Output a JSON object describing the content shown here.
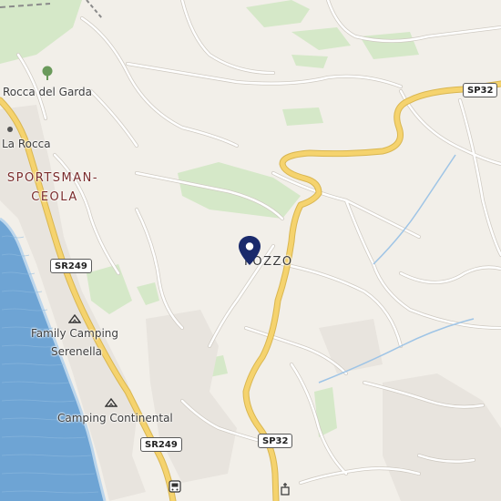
{
  "map": {
    "places": {
      "rocca_del_garda": "Rocca del Garda",
      "la_rocca": "La Rocca",
      "sportsman_line1": "SPORTSMAN-",
      "sportsman_line2": "CEOLA",
      "pozzo": "POZZO",
      "family_camping_line1": "Family Camping",
      "family_camping_line2": "Serenella",
      "camping_continental": "Camping Continental"
    },
    "roads": {
      "sp32_top": "SP32",
      "sr249_left": "SR249",
      "sr249_bottom": "SR249",
      "sp32_bottom": "SP32"
    },
    "icons": {
      "marker": "location-pin-icon",
      "camping": "campground-icon",
      "tree": "park-tree-icon",
      "bus": "bus-stop-icon",
      "church": "church-icon"
    },
    "colors": {
      "land": "#f2efe9",
      "water": "#6ea4d4",
      "green": "#cde6c0",
      "major_road": "#f5d36e",
      "marker": "#1a2a6c"
    }
  }
}
